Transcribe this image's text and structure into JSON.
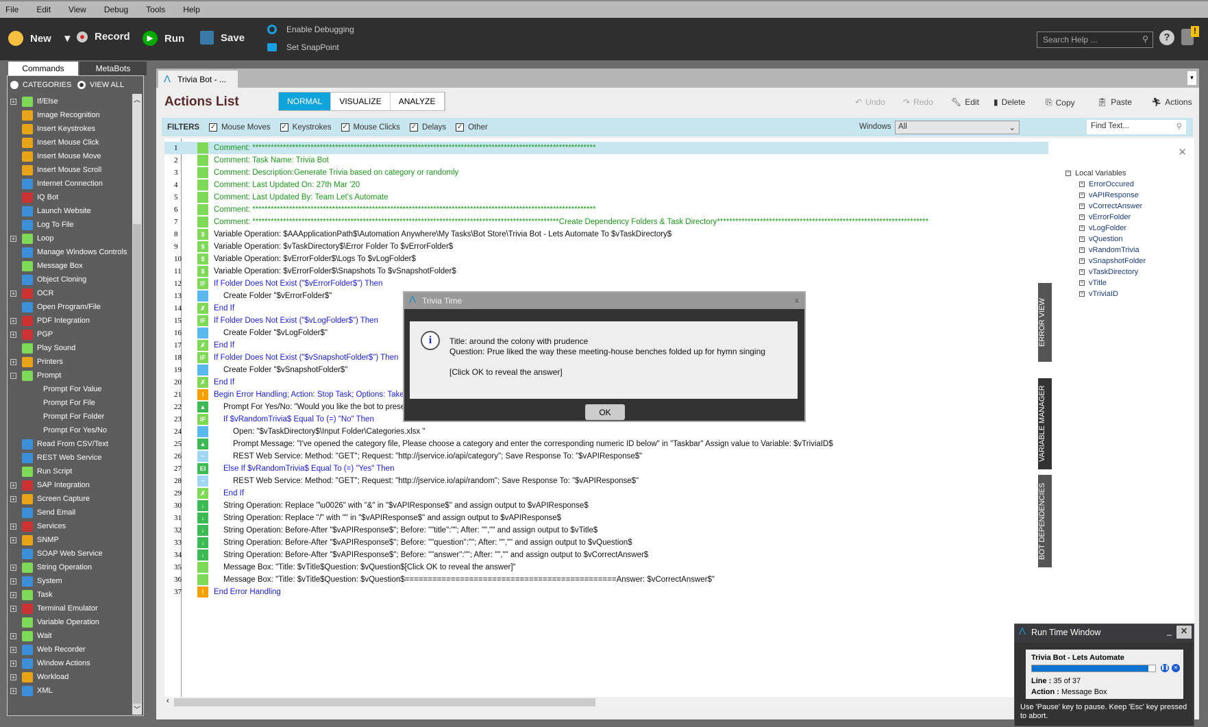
{
  "menu": [
    "File",
    "Edit",
    "View",
    "Debug",
    "Tools",
    "Help"
  ],
  "toolbar": {
    "new": "New",
    "record": "Record",
    "run": "Run",
    "save": "Save",
    "debug": "Enable Debugging",
    "snap": "Set SnapPoint",
    "search_placeholder": "Search Help ..."
  },
  "left": {
    "tabs": [
      "Commands",
      "MetaBots"
    ],
    "categories": "CATEGORIES",
    "view_all": "VIEW ALL",
    "items": [
      {
        "l": "If/Else",
        "e": "+",
        "c": "#7ed957"
      },
      {
        "l": "Image Recognition",
        "c": "#e8a317"
      },
      {
        "l": "Insert Keystrokes",
        "c": "#e8a317"
      },
      {
        "l": "Insert Mouse Click",
        "c": "#e8a317"
      },
      {
        "l": "Insert Mouse Move",
        "c": "#e8a317"
      },
      {
        "l": "Insert Mouse Scroll",
        "c": "#e8a317"
      },
      {
        "l": "Internet Connection",
        "c": "#3a8fd8"
      },
      {
        "l": "IQ Bot",
        "c": "#c33"
      },
      {
        "l": "Launch Website",
        "c": "#3a8fd8"
      },
      {
        "l": "Log To File",
        "c": "#3a8fd8"
      },
      {
        "l": "Loop",
        "e": "+",
        "c": "#7ed957"
      },
      {
        "l": "Manage Windows Controls",
        "c": "#3a8fd8"
      },
      {
        "l": "Message Box",
        "c": "#7ed957"
      },
      {
        "l": "Object Cloning",
        "c": "#3a8fd8"
      },
      {
        "l": "OCR",
        "e": "+",
        "c": "#c33"
      },
      {
        "l": "Open Program/File",
        "c": "#3a8fd8"
      },
      {
        "l": "PDF Integration",
        "e": "+",
        "c": "#c33"
      },
      {
        "l": "PGP",
        "e": "+",
        "c": "#c33"
      },
      {
        "l": "Play Sound",
        "c": "#7ed957"
      },
      {
        "l": "Printers",
        "e": "+",
        "c": "#e8a317"
      },
      {
        "l": "Prompt",
        "e": "-",
        "c": "#7ed957"
      },
      {
        "l": "Prompt For Value",
        "child": true
      },
      {
        "l": "Prompt For File",
        "child": true
      },
      {
        "l": "Prompt For Folder",
        "child": true
      },
      {
        "l": "Prompt For Yes/No",
        "child": true
      },
      {
        "l": "Read From CSV/Text",
        "c": "#3a8fd8"
      },
      {
        "l": "REST Web Service",
        "c": "#3a8fd8"
      },
      {
        "l": "Run Script",
        "c": "#7ed957"
      },
      {
        "l": "SAP Integration",
        "e": "+",
        "c": "#c33"
      },
      {
        "l": "Screen Capture",
        "e": "+",
        "c": "#e8a317"
      },
      {
        "l": "Send Email",
        "c": "#3a8fd8"
      },
      {
        "l": "Services",
        "e": "+",
        "c": "#c33"
      },
      {
        "l": "SNMP",
        "e": "+",
        "c": "#e8a317"
      },
      {
        "l": "SOAP Web Service",
        "c": "#3a8fd8"
      },
      {
        "l": "String Operation",
        "e": "+",
        "c": "#7ed957"
      },
      {
        "l": "System",
        "e": "+",
        "c": "#3a8fd8"
      },
      {
        "l": "Task",
        "e": "+",
        "c": "#7ed957"
      },
      {
        "l": "Terminal Emulator",
        "e": "+",
        "c": "#c33"
      },
      {
        "l": "Variable Operation",
        "c": "#7ed957"
      },
      {
        "l": "Wait",
        "e": "+",
        "c": "#7ed957"
      },
      {
        "l": "Web Recorder",
        "e": "+",
        "c": "#3a8fd8"
      },
      {
        "l": "Window Actions",
        "e": "+",
        "c": "#3a8fd8"
      },
      {
        "l": "Workload",
        "e": "+",
        "c": "#e8a317"
      },
      {
        "l": "XML",
        "e": "+",
        "c": "#3a8fd8"
      }
    ]
  },
  "main": {
    "doc_tab": "Trivia Bot - ...",
    "title": "Actions List",
    "views": [
      "NORMAL",
      "VISUALIZE",
      "ANALYZE"
    ],
    "actions": [
      "Undo",
      "Redo",
      "Edit",
      "Delete",
      "Copy",
      "Paste",
      "Actions"
    ],
    "filters_label": "FILTERS",
    "filters": [
      "Mouse Moves",
      "Keystrokes",
      "Mouse Clicks",
      "Delays",
      "Other"
    ],
    "windows_label": "Windows",
    "windows_value": "All",
    "find_placeholder": "Find Text...",
    "lines": [
      {
        "t": "Comment: ****************************************************************************************************************",
        "k": "c",
        "i": 0,
        "ic": "cm"
      },
      {
        "t": "Comment: Task Name: Trivia Bot",
        "k": "c",
        "i": 0,
        "ic": "cm"
      },
      {
        "t": "Comment: Description:Generate Trivia based on category or randomly",
        "k": "c",
        "i": 0,
        "ic": "cm"
      },
      {
        "t": "Comment: Last Updated On: 27th Mar '20",
        "k": "c",
        "i": 0,
        "ic": "cm"
      },
      {
        "t": "Comment: Last Updated By: Team Let's Automate",
        "k": "c",
        "i": 0,
        "ic": "cm"
      },
      {
        "t": "Comment: ****************************************************************************************************************",
        "k": "c",
        "i": 0,
        "ic": "cm"
      },
      {
        "t": "Comment: ****************************************************************************************************Create Dependency Folders & Task Directory*********************************************************************",
        "k": "c",
        "i": 0,
        "ic": "cm"
      },
      {
        "t": "Variable Operation: $AAApplicationPath$\\Automation Anywhere\\My Tasks\\Bot Store\\Trivia Bot - Lets Automate To $vTaskDirectory$",
        "k": "n",
        "i": 0,
        "ic": "var"
      },
      {
        "t": "Variable Operation: $vTaskDirectory$\\Error Folder To $vErrorFolder$",
        "k": "n",
        "i": 0,
        "ic": "var"
      },
      {
        "t": "Variable Operation: $vErrorFolder$\\Logs To $vLogFolder$",
        "k": "n",
        "i": 0,
        "ic": "var"
      },
      {
        "t": "Variable Operation: $vErrorFolder$\\Snapshots To $vSnapshotFolder$",
        "k": "n",
        "i": 0,
        "ic": "var"
      },
      {
        "t": "If Folder Does Not Exist (\"$vErrorFolder$\")  Then",
        "k": "b",
        "i": 0,
        "ic": "if"
      },
      {
        "t": "Create Folder \"$vErrorFolder$\"",
        "k": "n",
        "i": 1,
        "ic": "fold"
      },
      {
        "t": "End If",
        "k": "b",
        "i": 0,
        "ic": "end"
      },
      {
        "t": "If Folder Does Not Exist (\"$vLogFolder$\")  Then",
        "k": "b",
        "i": 0,
        "ic": "if"
      },
      {
        "t": "Create Folder \"$vLogFolder$\"",
        "k": "n",
        "i": 1,
        "ic": "fold"
      },
      {
        "t": "End If",
        "k": "b",
        "i": 0,
        "ic": "end"
      },
      {
        "t": "If Folder Does Not Exist (\"$vSnapshotFolder$\")  Then",
        "k": "b",
        "i": 0,
        "ic": "if"
      },
      {
        "t": "Create Folder \"$vSnapshotFolder$\"",
        "k": "n",
        "i": 1,
        "ic": "fold"
      },
      {
        "t": "End If",
        "k": "b",
        "i": 0,
        "ic": "end"
      },
      {
        "t": "Begin Error Handling; Action: Stop Task; Options: Take Snapshot",
        "k": "b",
        "i": 0,
        "ic": "warn"
      },
      {
        "t": "Prompt For Yes/No: \"Would you like the bot to present random trivia?\"",
        "k": "n",
        "i": 1,
        "ic": "prompt"
      },
      {
        "t": "If $vRandomTrivia$ Equal To (=) \"No\" Then",
        "k": "b",
        "i": 1,
        "ic": "if"
      },
      {
        "t": "Open: \"$vTaskDirectory$\\Input Folder\\Categories.xlsx \"",
        "k": "n",
        "i": 2,
        "ic": "fold"
      },
      {
        "t": "Prompt Message: \"I've opened the category file, Please choose a category and enter the corresponding numeric ID below\" in \"Taskbar\" Assign value to Variable: $vTriviaID$",
        "k": "n",
        "i": 2,
        "ic": "prompt"
      },
      {
        "t": "REST Web Service: Method: \"GET\"; Request: \"http://jservice.io/api/category\"; Save Response To: \"$vAPIResponse$\"",
        "k": "n",
        "i": 2,
        "ic": "rest"
      },
      {
        "t": "Else If $vRandomTrivia$ Equal To (=) \"Yes\" Then",
        "k": "b",
        "i": 1,
        "ic": "elif"
      },
      {
        "t": "REST Web Service: Method: \"GET\"; Request: \"http://jservice.io/api/random\"; Save Response To: \"$vAPIResponse$\"",
        "k": "n",
        "i": 2,
        "ic": "rest"
      },
      {
        "t": "End If",
        "k": "b",
        "i": 1,
        "ic": "end"
      },
      {
        "t": "String Operation: Replace \"\\u0026\" with \"&\" in \"$vAPIResponse$\" and assign output to $vAPIResponse$",
        "k": "n",
        "i": 1,
        "ic": "str"
      },
      {
        "t": "String Operation: Replace \"/\" with \"\" in \"$vAPIResponse$\" and assign output to $vAPIResponse$",
        "k": "n",
        "i": 1,
        "ic": "str"
      },
      {
        "t": "String Operation: Before-After \"$vAPIResponse$\"; Before: \"\"title\":\"\"; After: \"\",\"\" and assign output to $vTitle$",
        "k": "n",
        "i": 1,
        "ic": "str"
      },
      {
        "t": "String Operation: Before-After \"$vAPIResponse$\"; Before: \"\"question\":\"\"; After: \"\",\"\" and assign output to $vQuestion$",
        "k": "n",
        "i": 1,
        "ic": "str"
      },
      {
        "t": "String Operation: Before-After \"$vAPIResponse$\"; Before: \"\"answer\":\"\"; After: \"\",\"\" and assign output to $vCorrectAnswer$",
        "k": "n",
        "i": 1,
        "ic": "str"
      },
      {
        "t": "Message Box: \"Title: $vTitle$Question: $vQuestion$[Click OK to reveal the answer]\"",
        "k": "n",
        "i": 1,
        "ic": "msg"
      },
      {
        "t": "Message Box: \"Title: $vTitle$Question: $vQuestion$==============================================Answer: $vCorrectAnswer$\"",
        "k": "n",
        "i": 1,
        "ic": "msg"
      },
      {
        "t": "End Error Handling",
        "k": "b",
        "i": 0,
        "ic": "warn"
      }
    ]
  },
  "right": {
    "tabs": [
      "ERROR VIEW",
      "VARIABLE MANAGER",
      "BOT DEPENDENCIES"
    ],
    "root": "Local Variables",
    "vars": [
      "ErrorOccured",
      "vAPIResponse",
      "vCorrectAnswer",
      "vErrorFolder",
      "vLogFolder",
      "vQuestion",
      "vRandomTrivia",
      "vSnapshotFolder",
      "vTaskDirectory",
      "vTitle",
      "vTriviaID"
    ]
  },
  "dialog": {
    "title": "Trivia Time",
    "line1": "Title: around the colony with prudence",
    "line2": "Question: Prue liked the way these meeting-house benches folded up for hymn singing",
    "line3": "[Click OK to reveal the answer]",
    "ok": "OK",
    "close": "x"
  },
  "runtime": {
    "title": "Run Time Window",
    "bot": "Trivia Bot - Lets Automate",
    "progress": 0.946,
    "line_label": "Line :",
    "line_value": "35 of 37",
    "action_label": "Action :",
    "action_value": "Message Box",
    "hint": "Use 'Pause' key to pause. Keep 'Esc' key pressed to abort."
  }
}
